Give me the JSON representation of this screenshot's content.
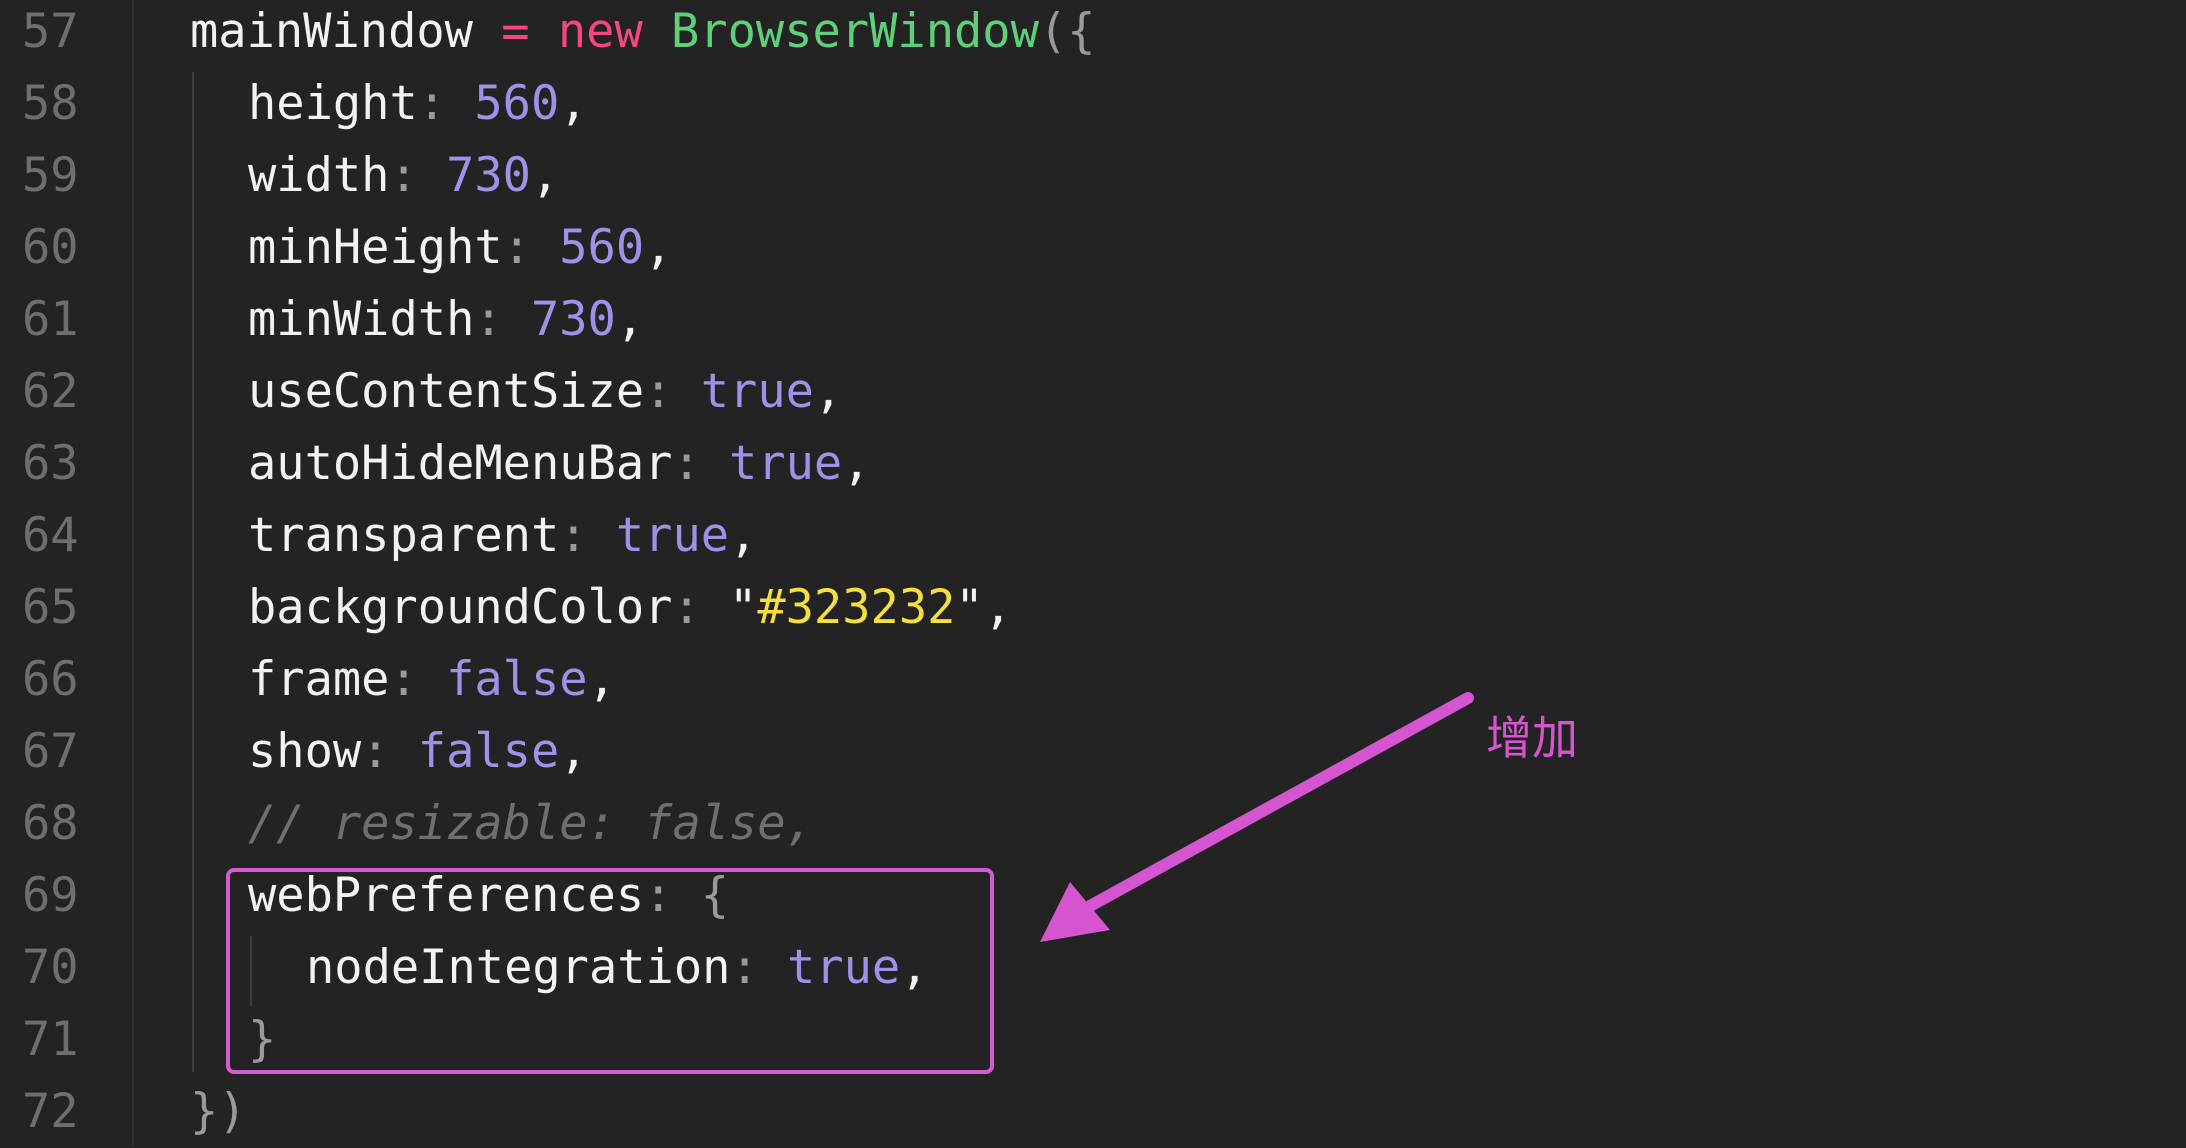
{
  "editor": {
    "lines": [
      {
        "number": "57",
        "indent": 0,
        "tokens": [
          {
            "t": "mainWindow ",
            "c": "plain"
          },
          {
            "t": "=",
            "c": "kw"
          },
          {
            "t": " ",
            "c": "plain"
          },
          {
            "t": "new",
            "c": "kw"
          },
          {
            "t": " ",
            "c": "plain"
          },
          {
            "t": "BrowserWindow",
            "c": "cls"
          },
          {
            "t": "({",
            "c": "punc"
          }
        ]
      },
      {
        "number": "58",
        "indent": 1,
        "tokens": [
          {
            "t": "height",
            "c": "plain"
          },
          {
            "t": ": ",
            "c": "punc"
          },
          {
            "t": "560",
            "c": "num"
          },
          {
            "t": ",",
            "c": "plain"
          }
        ]
      },
      {
        "number": "59",
        "indent": 1,
        "tokens": [
          {
            "t": "width",
            "c": "plain"
          },
          {
            "t": ": ",
            "c": "punc"
          },
          {
            "t": "730",
            "c": "num"
          },
          {
            "t": ",",
            "c": "plain"
          }
        ]
      },
      {
        "number": "60",
        "indent": 1,
        "tokens": [
          {
            "t": "minHeight",
            "c": "plain"
          },
          {
            "t": ": ",
            "c": "punc"
          },
          {
            "t": "560",
            "c": "num"
          },
          {
            "t": ",",
            "c": "plain"
          }
        ]
      },
      {
        "number": "61",
        "indent": 1,
        "tokens": [
          {
            "t": "minWidth",
            "c": "plain"
          },
          {
            "t": ": ",
            "c": "punc"
          },
          {
            "t": "730",
            "c": "num"
          },
          {
            "t": ",",
            "c": "plain"
          }
        ]
      },
      {
        "number": "62",
        "indent": 1,
        "tokens": [
          {
            "t": "useContentSize",
            "c": "plain"
          },
          {
            "t": ": ",
            "c": "punc"
          },
          {
            "t": "true",
            "c": "bool"
          },
          {
            "t": ",",
            "c": "plain"
          }
        ]
      },
      {
        "number": "63",
        "indent": 1,
        "tokens": [
          {
            "t": "autoHideMenuBar",
            "c": "plain"
          },
          {
            "t": ": ",
            "c": "punc"
          },
          {
            "t": "true",
            "c": "bool"
          },
          {
            "t": ",",
            "c": "plain"
          }
        ]
      },
      {
        "number": "64",
        "indent": 1,
        "tokens": [
          {
            "t": "transparent",
            "c": "plain"
          },
          {
            "t": ": ",
            "c": "punc"
          },
          {
            "t": "true",
            "c": "bool"
          },
          {
            "t": ",",
            "c": "plain"
          }
        ]
      },
      {
        "number": "65",
        "indent": 1,
        "tokens": [
          {
            "t": "backgroundColor",
            "c": "plain"
          },
          {
            "t": ": ",
            "c": "punc"
          },
          {
            "t": "\"",
            "c": "str-q"
          },
          {
            "t": "#323232",
            "c": "hex"
          },
          {
            "t": "\"",
            "c": "str-q"
          },
          {
            "t": ",",
            "c": "plain"
          }
        ]
      },
      {
        "number": "66",
        "indent": 1,
        "tokens": [
          {
            "t": "frame",
            "c": "plain"
          },
          {
            "t": ": ",
            "c": "punc"
          },
          {
            "t": "false",
            "c": "bool"
          },
          {
            "t": ",",
            "c": "plain"
          }
        ]
      },
      {
        "number": "67",
        "indent": 1,
        "tokens": [
          {
            "t": "show",
            "c": "plain"
          },
          {
            "t": ": ",
            "c": "punc"
          },
          {
            "t": "false",
            "c": "bool"
          },
          {
            "t": ",",
            "c": "plain"
          }
        ]
      },
      {
        "number": "68",
        "indent": 1,
        "tokens": [
          {
            "t": "// resizable: false,",
            "c": "cmt"
          }
        ]
      },
      {
        "number": "69",
        "indent": 1,
        "tokens": [
          {
            "t": "webPreferences",
            "c": "plain"
          },
          {
            "t": ": {",
            "c": "punc"
          }
        ]
      },
      {
        "number": "70",
        "indent": 2,
        "tokens": [
          {
            "t": "nodeIntegration",
            "c": "plain"
          },
          {
            "t": ": ",
            "c": "punc"
          },
          {
            "t": "true",
            "c": "bool"
          },
          {
            "t": ",",
            "c": "plain"
          }
        ]
      },
      {
        "number": "71",
        "indent": 1,
        "tokens": [
          {
            "t": "}",
            "c": "punc"
          }
        ]
      },
      {
        "number": "72",
        "indent": 0,
        "tokens": [
          {
            "t": "})",
            "c": "punc"
          }
        ]
      }
    ]
  },
  "annotation": {
    "label": "增加",
    "color": "#d455cf"
  },
  "colors": {
    "background": "#232323",
    "keyword": "#f5477c",
    "class": "#5fd07a",
    "number": "#9c92e8",
    "string_hex": "#f5de3d",
    "comment": "#6f6f6f",
    "highlight": "#d55bd4"
  }
}
